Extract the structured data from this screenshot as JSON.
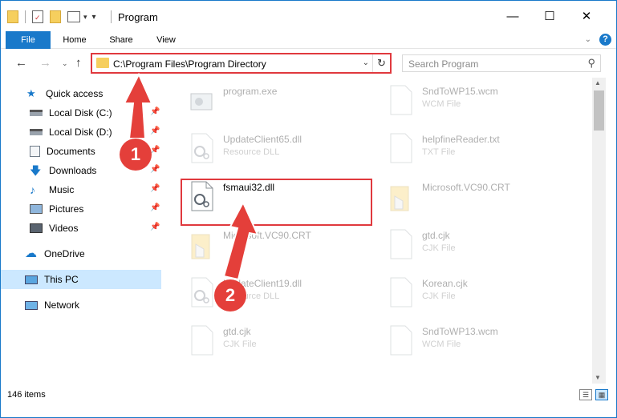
{
  "window": {
    "title": "Program",
    "controls": {
      "minimize": "—",
      "maximize": "☐",
      "close": "✕"
    }
  },
  "ribbon": {
    "tabs": [
      {
        "label": "File"
      },
      {
        "label": "Home"
      },
      {
        "label": "Share"
      },
      {
        "label": "View"
      }
    ]
  },
  "nav": {
    "address": "C:\\Program Files\\Program Directory",
    "search_placeholder": "Search Program"
  },
  "sidebar": {
    "items": [
      {
        "label": "Quick access",
        "icon": "star-icon"
      },
      {
        "label": "Local Disk (C:)",
        "icon": "drive-icon",
        "pinned": true
      },
      {
        "label": "Local Disk (D:)",
        "icon": "drive-icon",
        "pinned": true
      },
      {
        "label": "Documents",
        "icon": "documents-icon",
        "pinned": true
      },
      {
        "label": "Downloads",
        "icon": "download-icon",
        "pinned": true
      },
      {
        "label": "Music",
        "icon": "music-icon",
        "pinned": true
      },
      {
        "label": "Pictures",
        "icon": "pictures-icon",
        "pinned": true
      },
      {
        "label": "Videos",
        "icon": "videos-icon",
        "pinned": true
      },
      {
        "label": "OneDrive",
        "icon": "cloud-icon"
      },
      {
        "label": "This PC",
        "icon": "computer-icon",
        "active": true
      },
      {
        "label": "Network",
        "icon": "network-icon"
      }
    ]
  },
  "files": [
    {
      "name": "program.exe",
      "type": "",
      "kind": "exe",
      "faded": true
    },
    {
      "name": "SndToWP15.wcm",
      "type": "WCM File",
      "kind": "doc",
      "faded": true
    },
    {
      "name": "UpdateClient65.dll",
      "type": "Resource DLL",
      "kind": "dll",
      "faded": true
    },
    {
      "name": "helpfineReader.txt",
      "type": "TXT File",
      "kind": "doc",
      "faded": true
    },
    {
      "name": "fsmaui32.dll",
      "type": "",
      "kind": "dll",
      "faded": false
    },
    {
      "name": "Microsoft.VC90.CRT",
      "type": "",
      "kind": "folder",
      "faded": true
    },
    {
      "name": "Microsoft.VC90.CRT",
      "type": "",
      "kind": "folder",
      "faded": true
    },
    {
      "name": "gtd.cjk",
      "type": "CJK File",
      "kind": "doc",
      "faded": true
    },
    {
      "name": "UpdateClient19.dll",
      "type": "Resource DLL",
      "kind": "dll",
      "faded": true
    },
    {
      "name": "Korean.cjk",
      "type": "CJK File",
      "kind": "doc",
      "faded": true
    },
    {
      "name": "gtd.cjk",
      "type": "CJK File",
      "kind": "doc",
      "faded": true
    },
    {
      "name": "SndToWP13.wcm",
      "type": "WCM File",
      "kind": "doc",
      "faded": true
    }
  ],
  "status": {
    "count": "146 items"
  },
  "annotations": {
    "step1": "1",
    "step2": "2"
  },
  "colors": {
    "accent": "#1979ca",
    "highlight": "#e0393e",
    "folder": "#f6cf5e"
  }
}
